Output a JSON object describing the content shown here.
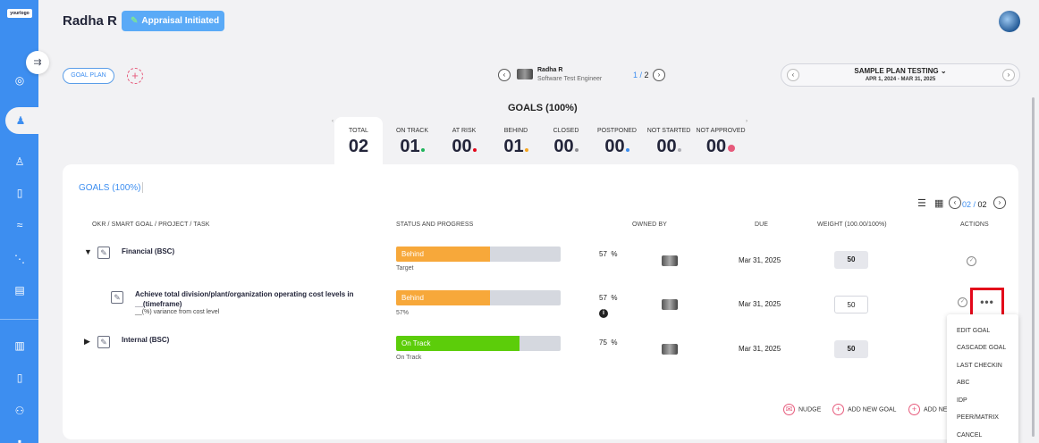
{
  "brand": {
    "logo_text": "yourlogo"
  },
  "header": {
    "user_name": "Radha R",
    "status_label": "Appraisal Initiated"
  },
  "toolbar": {
    "goal_plan_label": "GOAL PLAN",
    "employee": {
      "name": "Radha R",
      "role": "Software Test Engineer"
    },
    "pager": {
      "current": "1",
      "total": "2"
    },
    "plan": {
      "title": "SAMPLE PLAN TESTING",
      "dates": "APR 1, 2024 - MAR 31, 2025"
    }
  },
  "summary": {
    "heading": "GOALS (100%)",
    "stats": [
      {
        "label": "TOTAL",
        "value": "02"
      },
      {
        "label": "ON TRACK",
        "value": "01",
        "dot": "#1fb45a"
      },
      {
        "label": "AT RISK",
        "value": "00",
        "dot": "#e3071a"
      },
      {
        "label": "BEHIND",
        "value": "01",
        "dot": "#f5a623"
      },
      {
        "label": "CLOSED",
        "value": "00",
        "dot": "#8e8e93"
      },
      {
        "label": "POSTPONED",
        "value": "00",
        "dot": "#3d8ef0"
      },
      {
        "label": "NOT STARTED",
        "value": "00",
        "dot": "#b0b0b6"
      },
      {
        "label": "NOT APPROVED",
        "value": "00",
        "dot": "#e65a7b"
      }
    ]
  },
  "card": {
    "title": "GOALS (100%)",
    "pager": {
      "current": "02",
      "total": "02"
    },
    "columns": {
      "goal": "OKR / SMART GOAL / PROJECT / TASK",
      "status": "STATUS AND PROGRESS",
      "owner": "OWNED BY",
      "due": "DUE",
      "weight": "WEIGHT (100.00/100%)",
      "actions": "ACTIONS"
    },
    "rows": [
      {
        "title": "Financial (BSC)",
        "status": "Behind",
        "progress": 0.57,
        "note": "Target",
        "pct": "57",
        "pct_unit": "%",
        "due": "Mar 31, 2025",
        "weight": "50",
        "status_color": "#f7a83a"
      },
      {
        "title": "Achieve total division/plant/organization operating cost levels in",
        "title2": "__(timeframe)",
        "subtitle": "__(%) variance from cost level",
        "status": "Behind",
        "progress": 0.57,
        "note": "57%",
        "pct": "57",
        "pct_unit": "%",
        "due": "Mar 31, 2025",
        "weight": "50",
        "status_color": "#f7a83a"
      },
      {
        "title": "Internal (BSC)",
        "status": "On Track",
        "progress": 0.75,
        "note": "On Track",
        "pct": "75",
        "pct_unit": "%",
        "due": "Mar 31, 2025",
        "weight": "50",
        "status_color": "#5ccd0a"
      }
    ],
    "footer": {
      "nudge": "NUDGE",
      "add_goal": "ADD NEW GOAL",
      "add_other": "ADD NE"
    }
  },
  "action_menu": {
    "items": [
      "EDIT GOAL",
      "CASCADE GOAL",
      "LAST CHECKIN",
      "ABC",
      "IDP",
      "PEER/MATRIX",
      "CANCEL"
    ]
  }
}
